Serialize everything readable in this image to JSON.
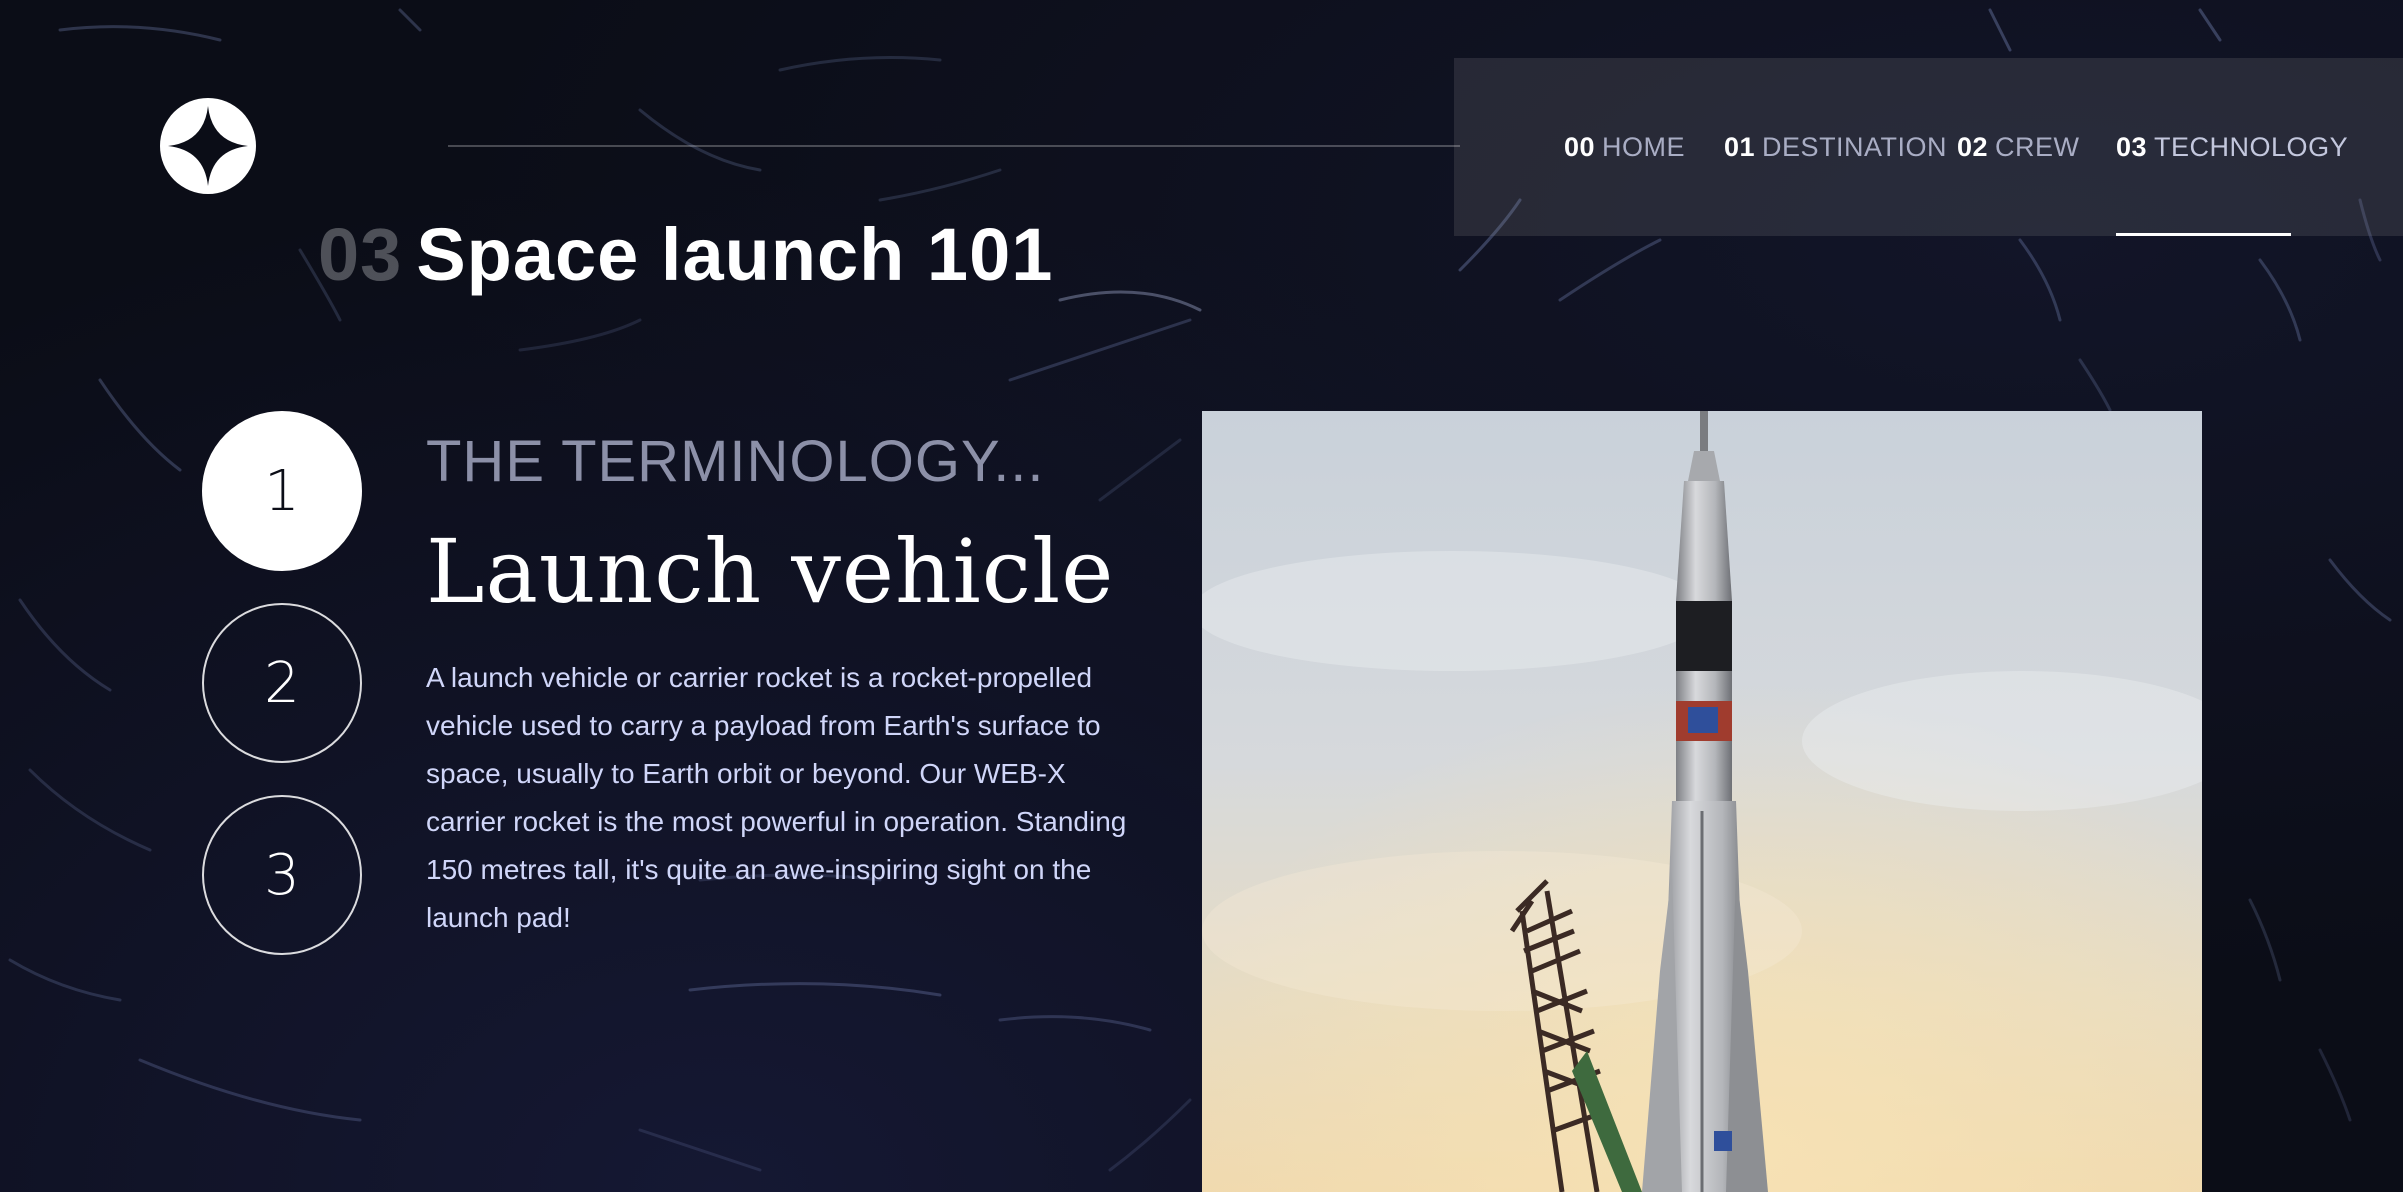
{
  "nav": {
    "items": [
      {
        "num": "00",
        "label": "HOME"
      },
      {
        "num": "01",
        "label": "DESTINATION"
      },
      {
        "num": "02",
        "label": "CREW"
      },
      {
        "num": "03",
        "label": "TECHNOLOGY"
      }
    ],
    "active_index": 3
  },
  "page": {
    "number": "03",
    "title": "Space launch 101"
  },
  "steps": [
    {
      "label": "1",
      "active": true
    },
    {
      "label": "2",
      "active": false
    },
    {
      "label": "3",
      "active": false
    }
  ],
  "content": {
    "eyebrow": "THE TERMINOLOGY...",
    "heading": "Launch vehicle",
    "body": "A launch vehicle or carrier rocket is a rocket-propelled vehicle used to carry a payload from Earth's surface to space, usually to Earth orbit or beyond. Our WEB-X carrier rocket is the most powerful in operation. Standing 150 metres tall, it's quite an awe-inspiring sight on the launch pad!"
  },
  "icons": {
    "logo": "star-logo-icon"
  },
  "colors": {
    "background": "#0b0d17",
    "nav_bg": "#26293a",
    "text_muted": "#d0d6f9",
    "white": "#ffffff"
  }
}
